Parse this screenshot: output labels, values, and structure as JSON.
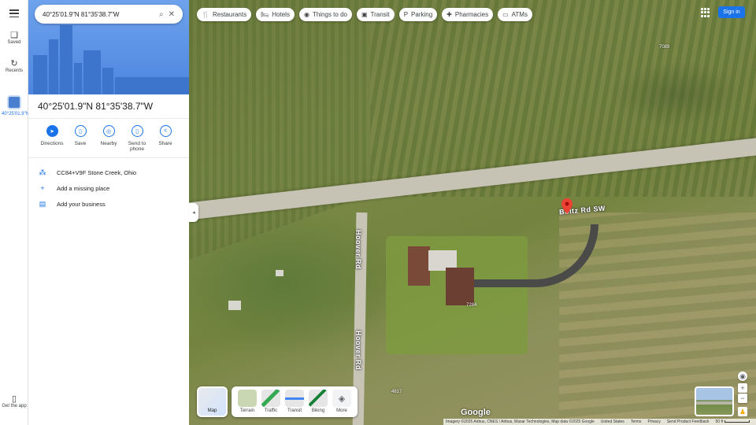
{
  "search": {
    "query": "40°25'01.9\"N 81°35'38.7\"W"
  },
  "rail": {
    "saved": "Saved",
    "recents": "Recents",
    "place_label": "40°25'01.9\"N",
    "get_app": "Get the app"
  },
  "place": {
    "title": "40°25'01.9\"N 81°35'38.7\"W",
    "actions": [
      {
        "label": "Directions",
        "icon": "directions-icon"
      },
      {
        "label": "Save",
        "icon": "bookmark-icon"
      },
      {
        "label": "Nearby",
        "icon": "nearby-icon"
      },
      {
        "label": "Send to phone",
        "icon": "phone-icon"
      },
      {
        "label": "Share",
        "icon": "share-icon"
      }
    ],
    "plus_code": "CC84+V9F Stone Creek, Ohio",
    "add_place": "Add a missing place",
    "add_business": "Add your business"
  },
  "chips": [
    "Restaurants",
    "Hotels",
    "Things to do",
    "Transit",
    "Parking",
    "Pharmacies",
    "ATMs"
  ],
  "header": {
    "sign_in": "Sign in"
  },
  "map": {
    "roads": {
      "boltz": "Boltz Rd SW",
      "hoover1": "Hoover Rd",
      "hoover2": "Hoover Rd"
    },
    "numbers": {
      "n1": "7089",
      "n2": "4617",
      "n3": "7284"
    },
    "toggle_label": "Map",
    "layers": [
      "Terrain",
      "Traffic",
      "Transit",
      "Biking",
      "More"
    ],
    "google": "Google"
  },
  "footer": {
    "imagery": "Imagery ©2025 Airbus, CNES / Airbus, Maxar Technologies, Map data ©2025 Google",
    "country": "United States",
    "terms": "Terms",
    "privacy": "Privacy",
    "feedback": "Send Product Feedback",
    "scale": "50 ft"
  }
}
